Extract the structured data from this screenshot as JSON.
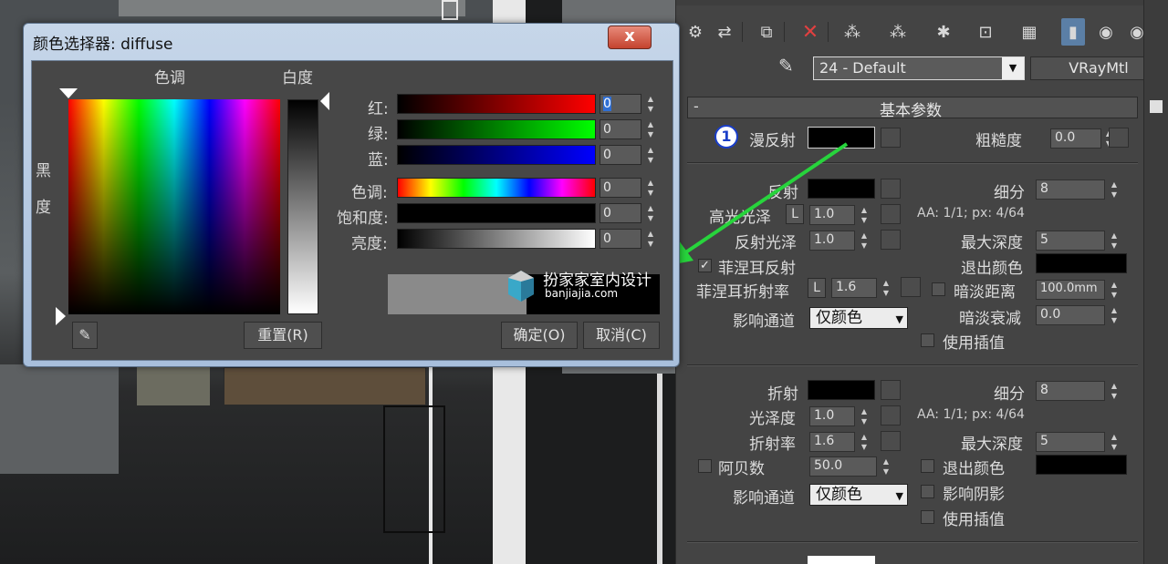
{
  "dialog": {
    "title": "颜色选择器: diffuse",
    "close_label": "x",
    "hue_label": "色调",
    "whiteness_label": "白度",
    "blackness_label_1": "黑",
    "blackness_label_2": "度",
    "channels": [
      {
        "label": "红:",
        "value": "0"
      },
      {
        "label": "绿:",
        "value": "0"
      },
      {
        "label": "蓝:",
        "value": "0"
      },
      {
        "label": "色调:",
        "value": "0"
      },
      {
        "label": "饱和度:",
        "value": "0"
      },
      {
        "label": "亮度:",
        "value": "0"
      }
    ],
    "reset_label": "重置(R)",
    "ok_label": "确定(O)",
    "cancel_label": "取消(C)",
    "watermark_title": "扮家家室内设计",
    "watermark_url": "banjiajia.com"
  },
  "panel": {
    "material_name": "24 - Default",
    "material_type": "VRayMtl",
    "section_title": "基本参数",
    "section_toggle": "-",
    "badge": "1",
    "diffuse_label": "漫反射",
    "roughness_label": "粗糙度",
    "roughness_value": "0.0",
    "reflect": {
      "reflect_label": "反射",
      "subdiv_label": "细分",
      "subdiv_value": "8",
      "hilight_label": "高光光泽",
      "lock": "L",
      "hilight_value": "1.0",
      "aa_text": "AA: 1/1; px: 4/64",
      "gloss_label": "反射光泽",
      "gloss_value": "1.0",
      "maxdepth_label": "最大深度",
      "maxdepth_value": "5",
      "fresnel_label": "菲涅耳反射",
      "fresnel_check": "✓",
      "exit_color_label": "退出颜色",
      "fresnel_ior_label": "菲涅耳折射率",
      "fresnel_ior_value": "1.6",
      "dim_dist_label": "暗淡距离",
      "dim_dist_value": "100.0mm",
      "affect_label": "影响通道",
      "affect_value": "仅颜色",
      "dim_falloff_label": "暗淡衰减",
      "dim_falloff_value": "0.0",
      "interp_label": "使用插值"
    },
    "refract": {
      "refract_label": "折射",
      "subdiv_label": "细分",
      "subdiv_value": "8",
      "gloss_label": "光泽度",
      "gloss_value": "1.0",
      "aa_text": "AA: 1/1; px: 4/64",
      "ior_label": "折射率",
      "ior_value": "1.6",
      "maxdepth_label": "最大深度",
      "maxdepth_value": "5",
      "abbe_label": "阿贝数",
      "abbe_value": "50.0",
      "exit_color_label": "退出颜色",
      "affect_label": "影响通道",
      "affect_value": "仅颜色",
      "affect_shadow_label": "影响阴影",
      "interp_label": "使用插值"
    }
  },
  "colors": {
    "arrow": "#27d43c",
    "active_tool": "#5b7fa6"
  }
}
